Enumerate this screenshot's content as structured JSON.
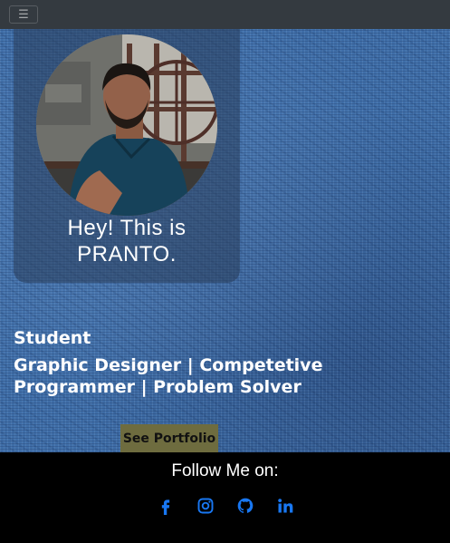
{
  "navbar": {
    "toggler_icon": "hamburger-icon",
    "toggler_glyph": "☰"
  },
  "profile": {
    "greeting_line1": "Hey! This is",
    "greeting_line2": "PRANTO.",
    "avatar_icon": "profile-photo"
  },
  "about": {
    "title": "Student",
    "detail": "Graphic Designer | Competetive Programmer | Problem Solver"
  },
  "cta": {
    "portfolio_label": "See Portfolio",
    "button_color": "#6e6c3f"
  },
  "footer": {
    "follow_label": "Follow Me on:",
    "icon_color": "#1877f2",
    "socials": [
      {
        "name": "facebook-icon"
      },
      {
        "name": "instagram-icon"
      },
      {
        "name": "github-icon"
      },
      {
        "name": "linkedin-icon"
      }
    ]
  }
}
